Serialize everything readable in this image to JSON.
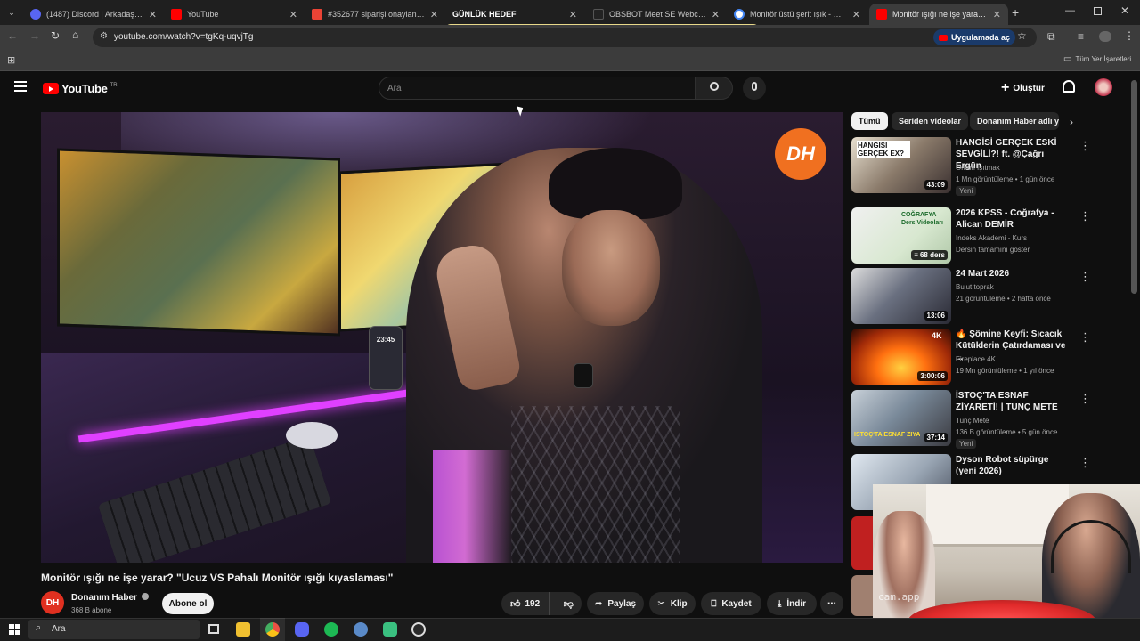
{
  "browser": {
    "tabs": [
      {
        "label": "(1487) Discord | Arkadaşlar",
        "color": "#5865f2"
      },
      {
        "label": "YouTube",
        "color": "#ff0000"
      },
      {
        "label": "#352677 siparişi onaylandı - m",
        "color": "#ea4335"
      },
      {
        "label": "GÜNLÜK HEDEF",
        "color": "#000000"
      },
      {
        "label": "OBSBOT Meet SE Webcam",
        "color": "#222222"
      },
      {
        "label": "Monitör üstü şerit ışık - Google",
        "color": "#4285f4"
      },
      {
        "label": "Monitör ışığı ne işe yarar? \"Ucu",
        "color": "#ff0000"
      }
    ],
    "url": "youtube.com/watch?v=tgKq-uqvjTg",
    "open_in_app": "Uygulamada aç",
    "bookmarks_all": "Tüm Yer İşaretleri"
  },
  "overlay": {
    "goal_label": "GÜNLÜK HEDEF",
    "goal_progress": 0.2
  },
  "youtube": {
    "logo": "YouTube",
    "country": "TR",
    "search_placeholder": "Ara",
    "create_label": "Oluştur"
  },
  "video": {
    "title": "Monitör ışığı ne işe yarar? \"Ucuz VS Pahalı Monitör ışığı kıyaslaması\"",
    "channel": "Donanım Haber",
    "subscribers": "368 B abone",
    "subscribe_label": "Abone ol",
    "likes": "192",
    "share_label": "Paylaş",
    "clip_label": "Klip",
    "save_label": "Kaydet",
    "download_label": "İndir",
    "phone_time": "23:45",
    "dh_logo": "DH"
  },
  "sidebar": {
    "chips": [
      "Tümü",
      "Seriden videolar",
      "Donanım Haber adlı y"
    ],
    "videos": [
      {
        "title": "HANGİSİ GERÇEK ESKİ SEVGİLİ?! ft. @Çağrı Ergün",
        "channel": "Orkun Işıtmak",
        "meta": "1 Mn görüntüleme • 1 gün önce",
        "badge": "Yeni",
        "duration": "43:09",
        "thumb_text": "HANGİSİ GERÇEK EX?",
        "color": "#b0a89a"
      },
      {
        "title": "2026 KPSS - Coğrafya - Alican DEMİR",
        "channel": "Indeks Akademi - Kurs",
        "meta": "Dersin tamamını göster",
        "badge": "",
        "duration": "68 ders",
        "thumb_text": "COĞRAFYA Ders Videoları",
        "color": "#d8e8d0"
      },
      {
        "title": "24 Mart 2026",
        "channel": "Bulut toprak",
        "meta": "21 görüntüleme • 2 hafta önce",
        "badge": "",
        "duration": "13:06",
        "thumb_text": "",
        "color": "#5a6070"
      },
      {
        "title": "🔥 Şömine Keyfi: Sıcacık Kütüklerin Çatırdaması ve ...",
        "channel": "Fireplace 4K",
        "meta": "19 Mn görüntüleme • 1 yıl önce",
        "badge": "",
        "duration": "3:00:06",
        "thumb_text": "4K",
        "color": "#c85010"
      },
      {
        "title": "İSTOÇ'TA ESNAF ZİYARETİ! | TUNÇ METE",
        "channel": "Tunç Mete",
        "meta": "136 B görüntüleme • 5 gün önce",
        "badge": "Yeni",
        "duration": "37:14",
        "thumb_text": "İSTOÇ'TA ESNAF ZİYARETİ",
        "color": "#7a8a9a"
      },
      {
        "title": "Dyson Robot süpürge (yeni 2026)",
        "channel": "",
        "meta": "",
        "badge": "",
        "duration": "",
        "thumb_text": "",
        "color": "#9aa6b4"
      }
    ]
  },
  "webcam": {
    "watermark": "cam.app"
  },
  "taskbar": {
    "search_placeholder": "Ara"
  }
}
